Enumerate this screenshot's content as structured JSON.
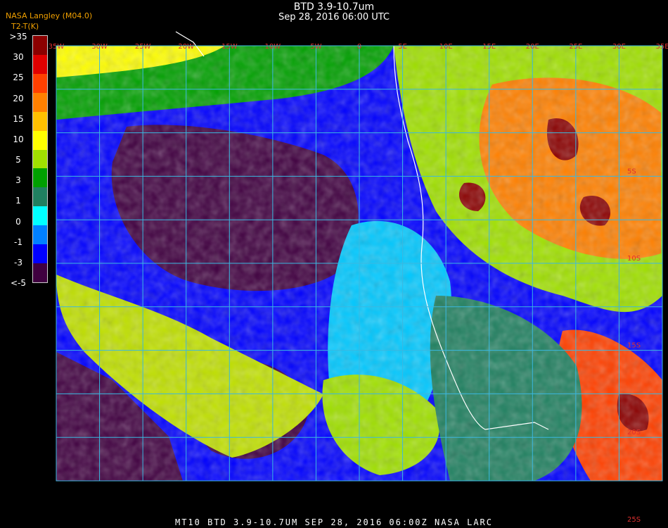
{
  "header": {
    "title": "BTD 3.9-10.7um",
    "datetime": "Sep 28, 2016 06:00 UTC",
    "org_line1": "NASA Langley (M04.0)",
    "org_line2": "T2-T(K)"
  },
  "legend": {
    "labels": [
      ">35",
      "30",
      "25",
      "20",
      "15",
      "10",
      "5",
      "3",
      "1",
      "0",
      "-1",
      "-3",
      "<-5"
    ],
    "colors": [
      "#8b0000",
      "#e00000",
      "#ff4000",
      "#ff8000",
      "#ffc000",
      "#ffff00",
      "#a0e000",
      "#00a000",
      "#208060",
      "#00ffff",
      "#0080ff",
      "#0000ff",
      "#400040"
    ]
  },
  "map": {
    "lon_labels": [
      "35W",
      "30W",
      "25W",
      "20W",
      "15W",
      "10W",
      "5W",
      "0",
      "5E",
      "10E",
      "15E",
      "20E",
      "25E",
      "30E",
      "35E"
    ],
    "lat_labels": [
      "5S",
      "10S",
      "15S",
      "20S",
      "25S"
    ]
  },
  "footer": {
    "text": "MT10   BTD 3.9-10.7UM    SEP 28, 2016 06:00Z    NASA LARC"
  }
}
